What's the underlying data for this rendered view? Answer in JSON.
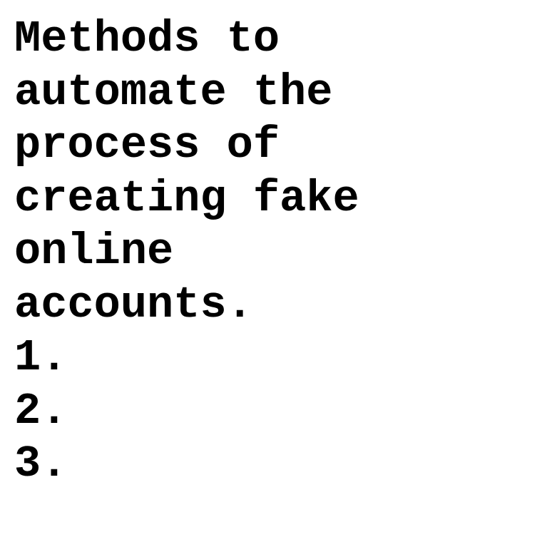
{
  "heading_lines": [
    "Methods to",
    "automate the",
    "process of",
    "creating fake",
    "online",
    "accounts."
  ],
  "list_markers": [
    "1.",
    "2.",
    "3."
  ]
}
